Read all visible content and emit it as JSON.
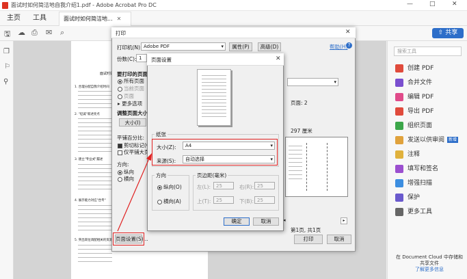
{
  "window": {
    "title": "面试时如何简洁地自我介绍1.pdf - Adobe Acrobat Pro DC",
    "controls": [
      "—",
      "□",
      "✕"
    ]
  },
  "menubar": {
    "home": "主页",
    "tools": "工具",
    "doc_tab": "面试时如何简洁地..."
  },
  "toolbar": {
    "share": "共享"
  },
  "document": {
    "heading": "面试时如何简洁地自我介绍",
    "items": [
      "1. 合理分配自我介绍时间",
      "2. \"坦诚\"叙述亮点",
      "3. 建立\"专业式\"履述",
      "4. 展示能力对应\"合专\"",
      "5. 突出岗位调配相关的资源"
    ]
  },
  "right_panel": {
    "search_placeholder": "搜索工具",
    "items": [
      {
        "label": "创建 PDF",
        "color": "#e04b3c"
      },
      {
        "label": "合并文件",
        "color": "#7a4fcf"
      },
      {
        "label": "编辑 PDF",
        "color": "#e04b8a"
      },
      {
        "label": "导出 PDF",
        "color": "#e04b3c"
      },
      {
        "label": "组织页面",
        "color": "#3ca64a"
      },
      {
        "label": "发送以供审阅",
        "color": "#e0a23c",
        "badge": "新增"
      },
      {
        "label": "注释",
        "color": "#e0b13c"
      },
      {
        "label": "填写和签名",
        "color": "#9b4fcf"
      },
      {
        "label": "增强扫描",
        "color": "#3c8ee0"
      },
      {
        "label": "保护",
        "color": "#6a5acd"
      },
      {
        "label": "更多工具",
        "color": "#666"
      }
    ],
    "footer_text": "在 Document Cloud 中存储和共享文件",
    "footer_link": "了解更多信息"
  },
  "print_dialog": {
    "title": "打印",
    "printer_label": "打印机(N):",
    "printer_value": "Adobe PDF",
    "properties": "属性(P)",
    "advanced": "高级(D)",
    "help": "帮助(H)",
    "copies_label": "份数(C):",
    "copies_value": "1",
    "pages_heading": "要打印的页面",
    "all_pages": "所有页面",
    "current_page": "当前页面",
    "pages": "页面",
    "more_options": "更多选项",
    "size_heading": "调整页面大小",
    "size_btn": "大小(I)",
    "tile_label": "平铺百分比:",
    "crop_marks": "剪切标记(O)",
    "tile_large": "仅平铺大页面",
    "orientation": "方向:",
    "portrait": "纵向",
    "landscape": "横向",
    "page_info": "页面: 2",
    "paper_size": "297 厘米",
    "page_count": "第1页, 共1页",
    "page_setup_btn": "页面设置(S)...",
    "print_btn": "打印",
    "cancel_btn": "取消"
  },
  "page_setup": {
    "title": "页面设置",
    "paper_group": "纸张",
    "size_label": "大小(Z):",
    "size_value": "A4",
    "source_label": "来源(S):",
    "source_value": "自动选择",
    "orientation_group": "方向",
    "portrait": "纵向(O)",
    "landscape": "横向(A)",
    "margins_group": "页边距(毫米)",
    "left": "左(L):",
    "right": "右(R):",
    "top": "上(T):",
    "bottom": "下(B):",
    "margin_value": "25",
    "ok": "确定",
    "cancel": "取消"
  }
}
